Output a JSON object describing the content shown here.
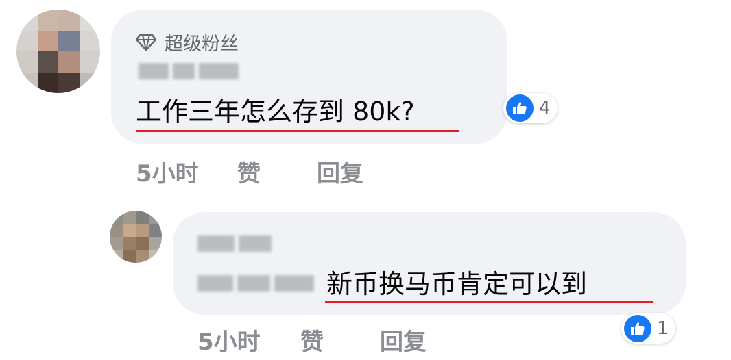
{
  "comment": {
    "badge_label": "超级粉丝",
    "author_name": "",
    "text": "工作三年怎么存到 80k?",
    "like_count": "4",
    "time": "5小时",
    "like_action": "赞",
    "reply_action": "回复"
  },
  "reply": {
    "author_name": "",
    "mention_name": "",
    "text": "新币换马币肯定可以到",
    "like_count": "1",
    "time": "5小时",
    "like_action": "赞",
    "reply_action": "回复"
  },
  "colors": {
    "bubble": "#f0f2f5",
    "underline": "#e41e26",
    "like_blue": "#1877f2",
    "meta_gray": "#8a8d91"
  }
}
